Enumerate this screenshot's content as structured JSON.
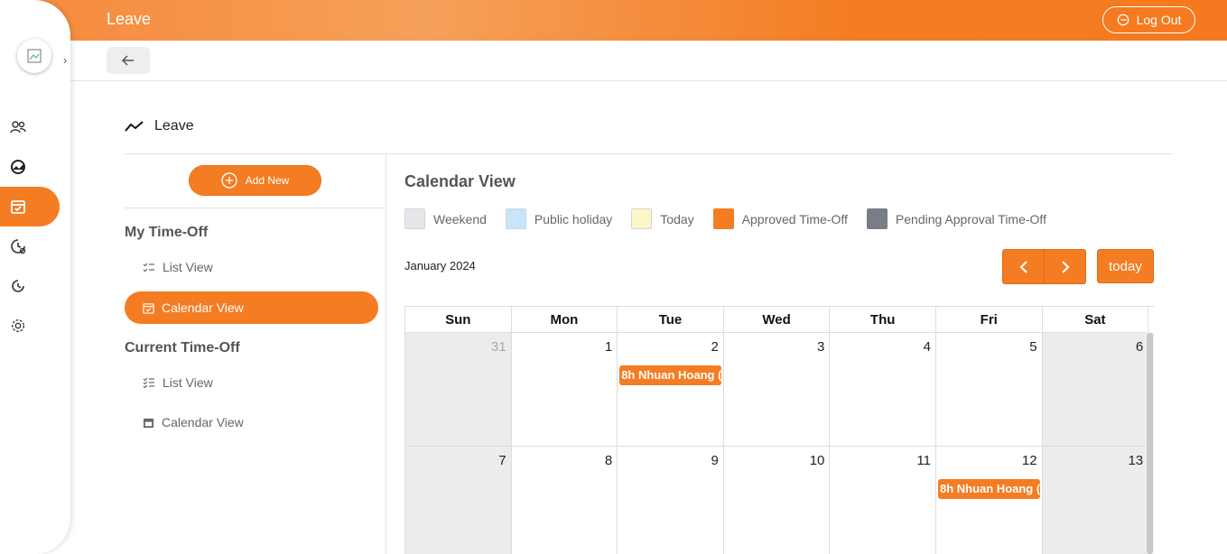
{
  "header": {
    "title": "Leave",
    "logout_label": "Log Out"
  },
  "page": {
    "heading": "Leave"
  },
  "left_panel": {
    "add_new_label": "Add New",
    "my_time_off": {
      "title": "My Time-Off",
      "list_view": "List View",
      "calendar_view": "Calendar View"
    },
    "current_time_off": {
      "title": "Current Time-Off",
      "list_view": "List View",
      "calendar_view": "Calendar View"
    }
  },
  "calendar": {
    "title": "Calendar View",
    "legend": [
      {
        "label": "Weekend",
        "color": "#e4e6ea"
      },
      {
        "label": "Public holiday",
        "color": "#c7e5fb"
      },
      {
        "label": "Today",
        "color": "#fdf6c6"
      },
      {
        "label": "Approved Time-Off",
        "color": "#f47c22"
      },
      {
        "label": "Pending Approval Time-Off",
        "color": "#787d87"
      }
    ],
    "month_label": "January 2024",
    "today_label": "today",
    "days_of_week": [
      "Sun",
      "Mon",
      "Tue",
      "Wed",
      "Thu",
      "Fri",
      "Sat"
    ],
    "weeks": [
      [
        {
          "n": "31",
          "other": true
        },
        {
          "n": "1"
        },
        {
          "n": "2",
          "event": "8h Nhuan Hoang ("
        },
        {
          "n": "3"
        },
        {
          "n": "4"
        },
        {
          "n": "5"
        },
        {
          "n": "6"
        }
      ],
      [
        {
          "n": "7"
        },
        {
          "n": "8"
        },
        {
          "n": "9"
        },
        {
          "n": "10"
        },
        {
          "n": "11"
        },
        {
          "n": "12",
          "event": "8h Nhuan Hoang ("
        },
        {
          "n": "13"
        }
      ]
    ]
  },
  "colors": {
    "accent": "#f47c22",
    "weekend_bg": "#ececec"
  }
}
